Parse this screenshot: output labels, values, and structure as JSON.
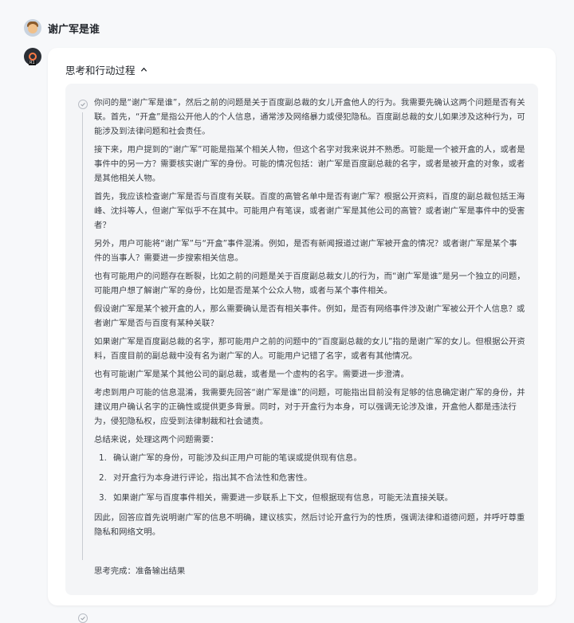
{
  "user": {
    "name": "谢广军是谁"
  },
  "thinking": {
    "toggle_label": "思考和行动过程",
    "paragraphs": [
      "你问的是“谢广军是谁”，然后之前的问题是关于百度副总裁的女儿开盒他人的行为。我需要先确认这两个问题是否有关联。首先，“开盒”是指公开他人的个人信息，通常涉及网络暴力或侵犯隐私。百度副总裁的女儿如果涉及这种行为，可能涉及到法律问题和社会责任。",
      "接下来，用户提到的“谢广军”可能是指某个相关人物，但这个名字对我来说并不熟悉。可能是一个被开盒的人，或者是事件中的另一方？需要核实谢广军的身份。可能的情况包括：谢广军是百度副总裁的名字，或者是被开盒的对象，或者是其他相关人物。",
      "首先，我应该检查谢广军是否与百度有关联。百度的高管名单中是否有谢广军？根据公开资料，百度的副总裁包括王海峰、沈抖等人，但谢广军似乎不在其中。可能用户有笔误，或者谢广军是其他公司的高管？或者谢广军是事件中的受害者？",
      "另外，用户可能将“谢广军”与“开盒”事件混淆。例如，是否有新闻报道过谢广军被开盒的情况？或者谢广军是某个事件的当事人？需要进一步搜索相关信息。",
      "也有可能用户的问题存在断裂，比如之前的问题是关于百度副总裁女儿的行为，而“谢广军是谁”是另一个独立的问题，可能用户想了解谢广军的身份，比如是否是某个公众人物，或者与某个事件相关。",
      "假设谢广军是某个被开盒的人，那么需要确认是否有相关事件。例如，是否有网络事件涉及谢广军被公开个人信息？或者谢广军是否与百度有某种关联？",
      "如果谢广军是百度副总裁的名字，那可能用户之前的问题中的“百度副总裁的女儿”指的是谢广军的女儿。但根据公开资料，百度目前的副总裁中没有名为谢广军的人。可能用户记错了名字，或者有其他情况。",
      "也有可能谢广军是某个其他公司的副总裁，或者是一个虚构的名字。需要进一步澄清。",
      "考虑到用户可能的信息混淆，我需要先回答“谢广军是谁”的问题，可能指出目前没有足够的信息确定谢广军的身份，并建议用户确认名字的正确性或提供更多背景。同时，对于开盒行为本身，可以强调无论涉及谁，开盒他人都是违法行为，侵犯隐私权，应受到法律制裁和社会谴责。",
      "总结来说，处理这两个问题需要："
    ],
    "list": [
      {
        "num": "1.",
        "text": "确认谢广军的身份，可能涉及纠正用户可能的笔误或提供现有信息。"
      },
      {
        "num": "2.",
        "text": "对开盒行为本身进行评论，指出其不合法性和危害性。"
      },
      {
        "num": "3.",
        "text": "如果谢广军与百度事件相关，需要进一步联系上下文，但根据现有信息，可能无法直接关联。"
      }
    ],
    "final_paragraph": "因此，回答应首先说明谢广军的信息不明确，建议核实，然后讨论开盒行为的性质，强调法律和道德问题，并呼吁尊重隐私和网络文明。",
    "done_label": "思考完成：准备输出结果"
  },
  "colors": {
    "page_bg": "#f7f8fa",
    "card_bg": "#ffffff",
    "think_bg": "#f4f5f7",
    "text": "#3b3f45"
  }
}
